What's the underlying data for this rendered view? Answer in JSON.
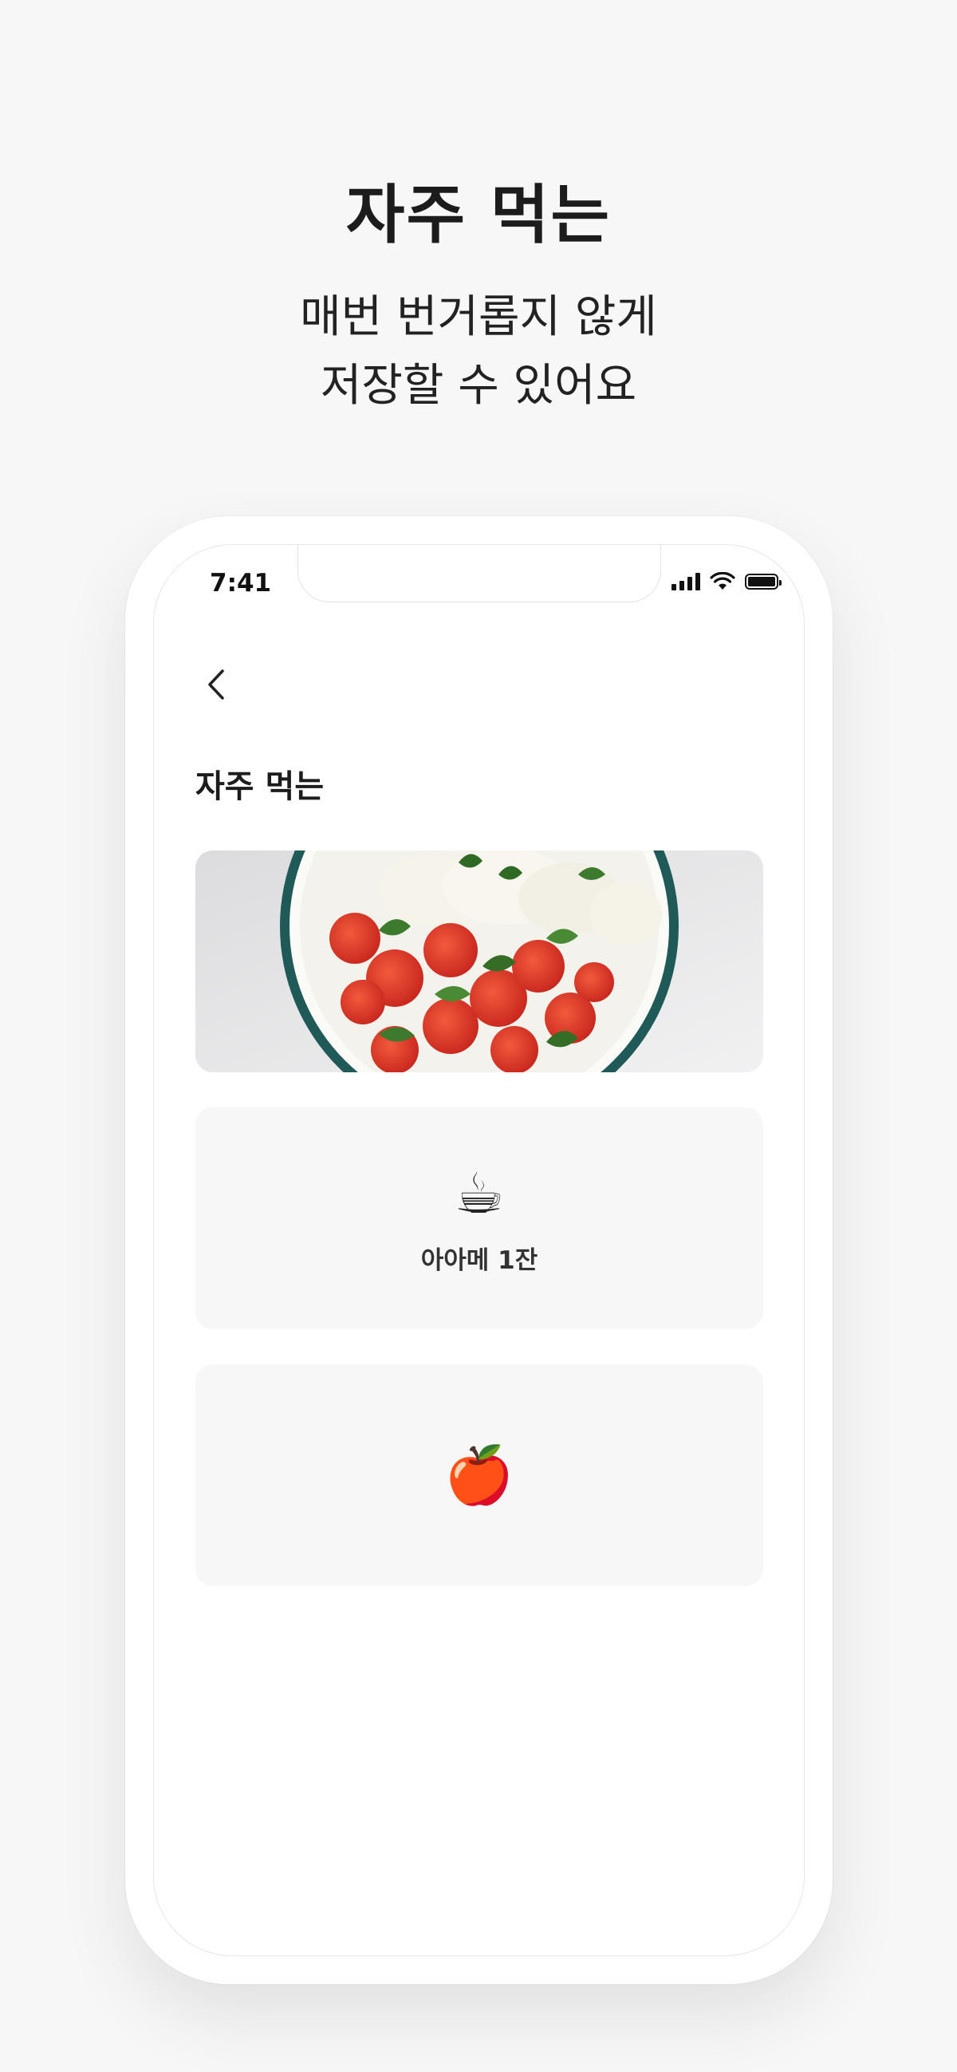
{
  "hero": {
    "title": "자주 먹는",
    "subtitle_line1": "매번 번거롭지 않게",
    "subtitle_line2": "저장할 수 있어요"
  },
  "status_bar": {
    "time": "7:41",
    "icons": [
      "signal-icon",
      "wifi-icon",
      "battery-icon"
    ]
  },
  "screen": {
    "back_icon": "chevron-left-icon",
    "title": "자주 먹는",
    "items": [
      {
        "type": "photo",
        "image": "tomato-mozzarella-salad-photo"
      },
      {
        "type": "emoji",
        "emoji": "☕",
        "label": "아아메 1잔"
      },
      {
        "type": "emoji",
        "emoji": "🍎",
        "label": ""
      }
    ]
  },
  "colors": {
    "background": "#f7f7f7",
    "card": "#f7f7f7",
    "plate_rim": "#1f5a58",
    "text": "#222222"
  }
}
